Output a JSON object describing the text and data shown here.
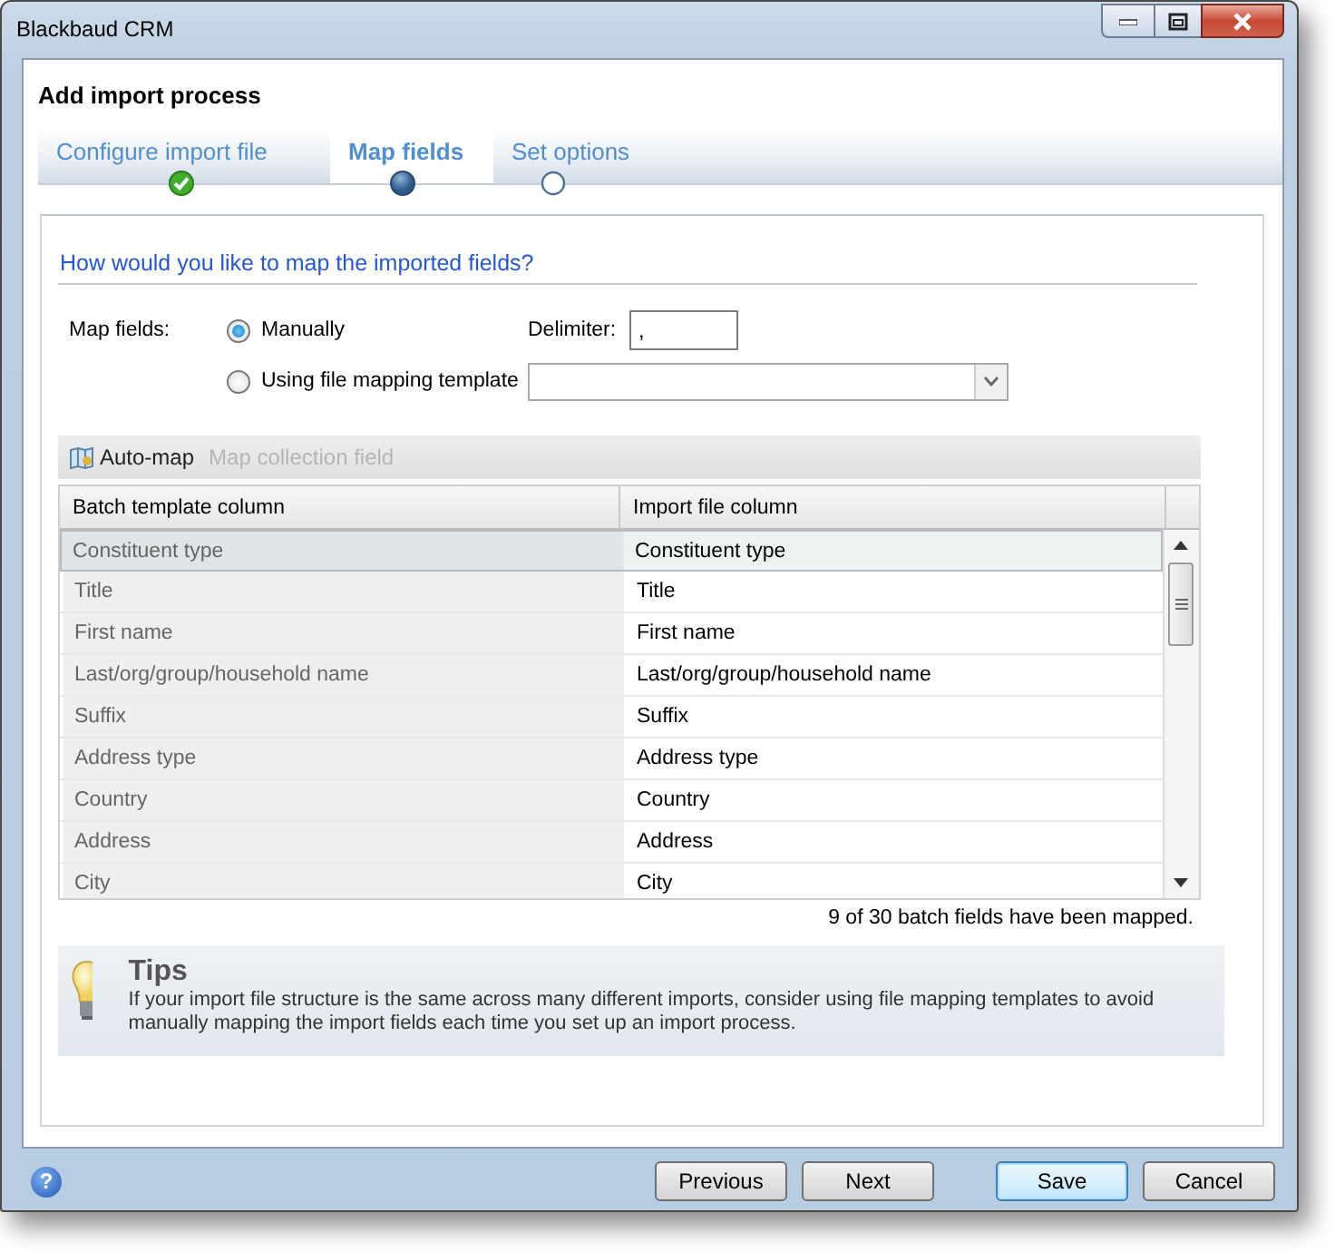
{
  "window": {
    "title": "Blackbaud CRM"
  },
  "dialog_title": "Add import process",
  "steps": [
    {
      "label": "Configure import file",
      "kind": "done",
      "selected": false
    },
    {
      "label": "Map fields",
      "kind": "current",
      "selected": true
    },
    {
      "label": "Set options",
      "kind": "pending",
      "selected": false
    }
  ],
  "question": "How would you like to map the imported fields?",
  "map_fields": {
    "label": "Map fields:",
    "options": [
      {
        "label": "Manually",
        "selected": true
      },
      {
        "label": "Using file mapping template",
        "selected": false
      }
    ],
    "delimiter_label": "Delimiter:",
    "delimiter_value": ","
  },
  "toolbar": [
    {
      "label": "Auto-map",
      "kind": "icon",
      "disabled": false
    },
    {
      "label": "Map collection field",
      "kind": "plain",
      "disabled": true
    }
  ],
  "grid": {
    "columns": [
      "Batch template column",
      "Import file column"
    ],
    "rows": [
      {
        "batch": "Constituent type",
        "import": "Constituent type",
        "selected": true
      },
      {
        "batch": "Title",
        "import": "Title",
        "selected": false
      },
      {
        "batch": "First name",
        "import": "First name",
        "selected": false
      },
      {
        "batch": "Last/org/group/household name",
        "import": "Last/org/group/household name",
        "selected": false
      },
      {
        "batch": "Suffix",
        "import": "Suffix",
        "selected": false
      },
      {
        "batch": "Address type",
        "import": "Address type",
        "selected": false
      },
      {
        "batch": "Country",
        "import": "Country",
        "selected": false
      },
      {
        "batch": "Address",
        "import": "Address",
        "selected": false
      },
      {
        "batch": "City",
        "import": "City",
        "selected": false
      }
    ]
  },
  "status": "9 of 30 batch fields have been mapped.",
  "tips": {
    "title": "Tips",
    "text": "If your import file structure is the same across many different imports, consider using file mapping templates to avoid manually mapping the import fields each time you set up an import process."
  },
  "help": "?",
  "buttons": [
    {
      "label": "Previous",
      "default": false
    },
    {
      "label": "Next",
      "default": false
    },
    {
      "label": "Save",
      "default": true
    },
    {
      "label": "Cancel",
      "default": false
    }
  ]
}
